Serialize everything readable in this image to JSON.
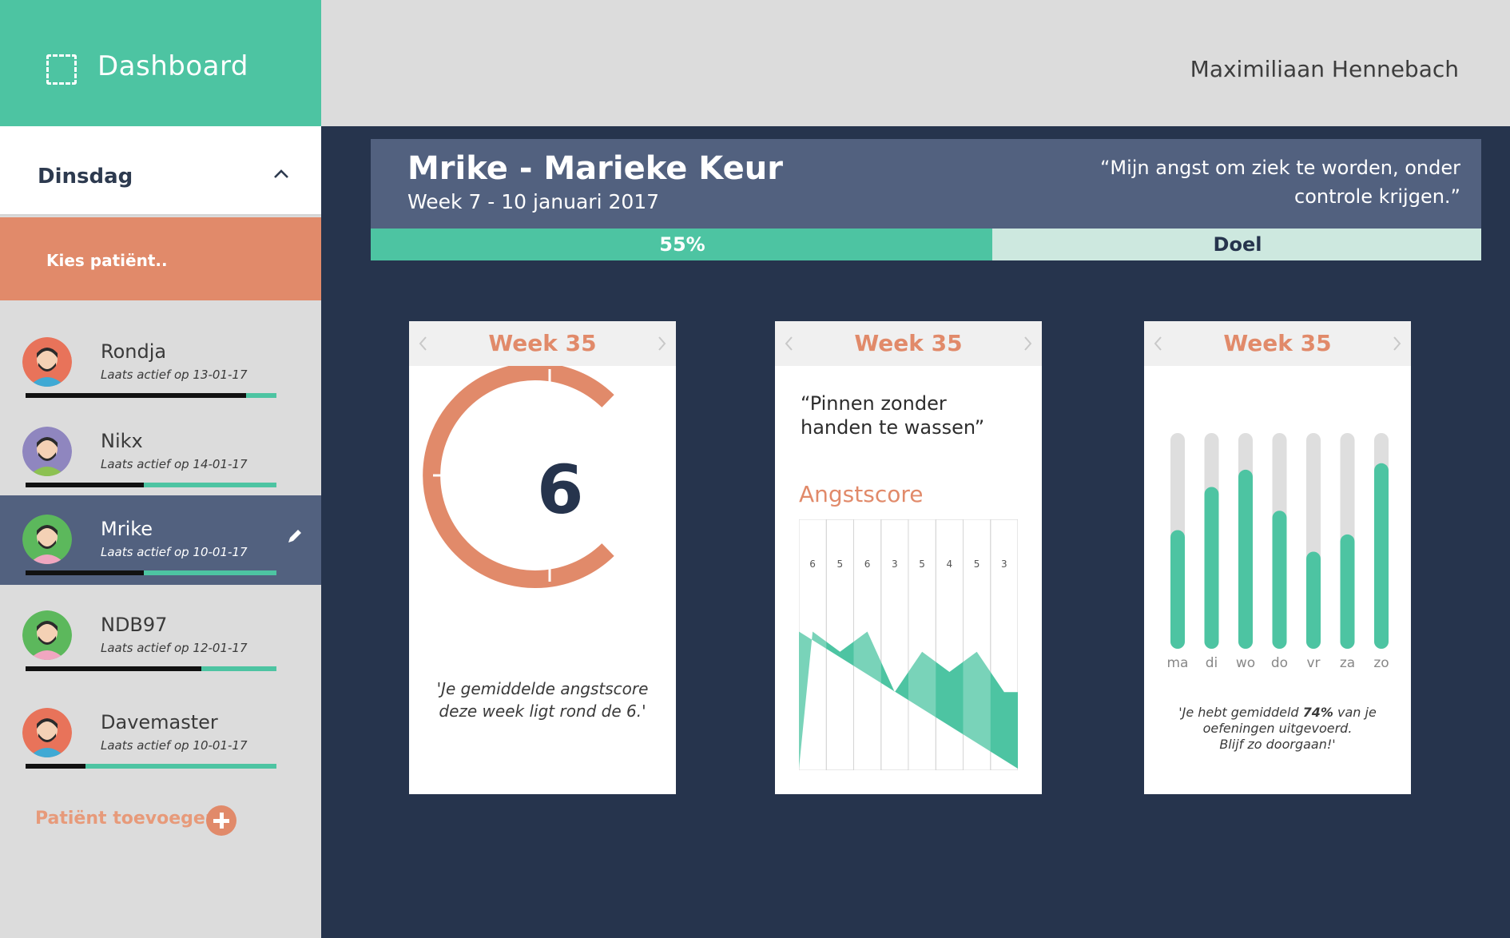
{
  "sidebar": {
    "brand_title": "Dashboard",
    "day_label": "Dinsdag",
    "select_patient_label": "Kies patiënt..",
    "add_patient_label": "Patiënt toevoegen",
    "patients": [
      {
        "name": "Rondja",
        "last_active": "Laats actief op 13-01-17",
        "progress": 0.88
      },
      {
        "name": "Nikx",
        "last_active": "Laats actief op 14-01-17",
        "progress": 0.47
      },
      {
        "name": "Mrike",
        "last_active": "Laats actief op 10-01-17",
        "progress": 0.47,
        "active": true
      },
      {
        "name": "NDB97",
        "last_active": "Laats actief op 12-01-17",
        "progress": 0.7
      },
      {
        "name": "Davemaster",
        "last_active": "Laats actief op 10-01-17",
        "progress": 0.24
      }
    ]
  },
  "topbar": {
    "username": "Maximiliaan Hennebach"
  },
  "hero": {
    "title": "Mrike - Marieke Keur",
    "subtitle": "Week 7 - 10 januari 2017",
    "quote": "“Mijn angst  om ziek te worden, onder controle krijgen.”",
    "progress_value": 0.56,
    "progress_label": "55%",
    "goal_label": "Doel"
  },
  "cards": {
    "score_card": {
      "week": "Week 35",
      "score": "6",
      "caption": "'Je gemiddelde angstscore deze week ligt rond de 6.'"
    },
    "exercise_card": {
      "week": "Week 35",
      "quote": "“Pinnen zonder handen te wassen”",
      "angst_label": "Angstscore",
      "values": [
        6,
        5,
        6,
        3,
        5,
        4,
        5,
        3
      ]
    },
    "week_card": {
      "week": "Week 35",
      "days": [
        "ma",
        "di",
        "wo",
        "do",
        "vr",
        "za",
        "zo"
      ],
      "fill": [
        0.55,
        0.75,
        0.83,
        0.64,
        0.45,
        0.53,
        0.86
      ],
      "caption_pre": "'Je hebt gemiddeld ",
      "caption_pct": "74%",
      "caption_mid": " van je oefeningen uitgevoerd.",
      "caption_end": "Blijf zo doorgaan!'"
    }
  },
  "colors": {
    "teal": "#4dc4a2",
    "salmon": "#e18a6a",
    "navy": "#26344d",
    "slate": "#52617f"
  }
}
